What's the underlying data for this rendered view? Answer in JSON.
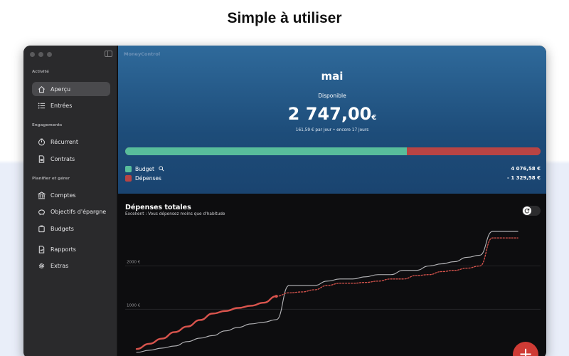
{
  "headline": "Simple à utiliser",
  "app_title": "MoneyControl",
  "sidebar": {
    "sections": [
      {
        "title": "Activité",
        "items": [
          {
            "label": "Aperçu",
            "icon": "house-icon",
            "active": true
          },
          {
            "label": "Entrées",
            "icon": "list-icon"
          }
        ]
      },
      {
        "title": "Engagements",
        "items": [
          {
            "label": "Récurrent",
            "icon": "timer-icon"
          },
          {
            "label": "Contrats",
            "icon": "document-icon"
          }
        ]
      },
      {
        "title": "Planifier et gérer",
        "items": [
          {
            "label": "Comptes",
            "icon": "bank-icon"
          },
          {
            "label": "Objectifs d'épargne",
            "icon": "piggy-bank-icon"
          },
          {
            "label": "Budgets",
            "icon": "wallet-icon"
          },
          {
            "label": "Rapports",
            "icon": "report-icon"
          },
          {
            "label": "Extras",
            "icon": "gear-icon"
          }
        ]
      }
    ]
  },
  "summary": {
    "month": "mai",
    "available_label": "Disponible",
    "amount": "2 747,00",
    "currency": "€",
    "per_day": "161,59 € par jour • encore 17 jours",
    "budget_share": 0.678,
    "colors": {
      "budget": "#58bd9b",
      "expenses": "#b84444"
    },
    "legend": [
      {
        "label": "Budget",
        "value": "4 076,58 €",
        "color": "#58bd9b"
      },
      {
        "label": "Dépenses",
        "value": "- 1 329,58 €",
        "color": "#b84444"
      }
    ]
  },
  "chart": {
    "title": "Dépenses totales",
    "subtitle": "Excellent : Vous dépensez moins que d'habitude",
    "toggle_icon": "refresh-icon",
    "add_button": "+"
  },
  "chart_data": {
    "type": "line",
    "title": "Dépenses totales",
    "ylabel_ticks": [
      "1000 €",
      "2000 €"
    ],
    "yticks": [
      1000,
      2000
    ],
    "ylim": [
      0,
      2900
    ],
    "xlim": [
      0,
      31
    ],
    "grid": true,
    "series": [
      {
        "name": "",
        "style": "solid-gray",
        "x": [
          0,
          1,
          2,
          3,
          4,
          5,
          6,
          7,
          8,
          9,
          10,
          11,
          12,
          13,
          14,
          15,
          16,
          17,
          18,
          19,
          20,
          21,
          22,
          23,
          24,
          25,
          26,
          27,
          28,
          29,
          30
        ],
        "y": [
          0,
          50,
          100,
          150,
          250,
          330,
          390,
          500,
          580,
          660,
          700,
          760,
          1550,
          1550,
          1550,
          1650,
          1700,
          1700,
          1750,
          1800,
          1800,
          1900,
          1900,
          2000,
          2050,
          2100,
          2200,
          2250,
          2800,
          2800,
          2800
        ]
      },
      {
        "name": "",
        "style": "solid-red",
        "x": [
          0,
          1,
          2,
          3,
          4,
          5,
          6,
          7,
          8,
          9,
          10,
          11
        ],
        "y": [
          80,
          200,
          320,
          470,
          600,
          750,
          900,
          960,
          1030,
          1080,
          1150,
          1300
        ]
      },
      {
        "name": "",
        "style": "dotted-red",
        "x": [
          11,
          12,
          13,
          14,
          15,
          16,
          17,
          18,
          19,
          20,
          21,
          22,
          23,
          24,
          25,
          26,
          27,
          28,
          29,
          30
        ],
        "y": [
          1300,
          1380,
          1400,
          1450,
          1550,
          1600,
          1600,
          1620,
          1650,
          1700,
          1700,
          1780,
          1800,
          1870,
          1900,
          1950,
          2000,
          2650,
          2650,
          2650
        ]
      }
    ]
  }
}
